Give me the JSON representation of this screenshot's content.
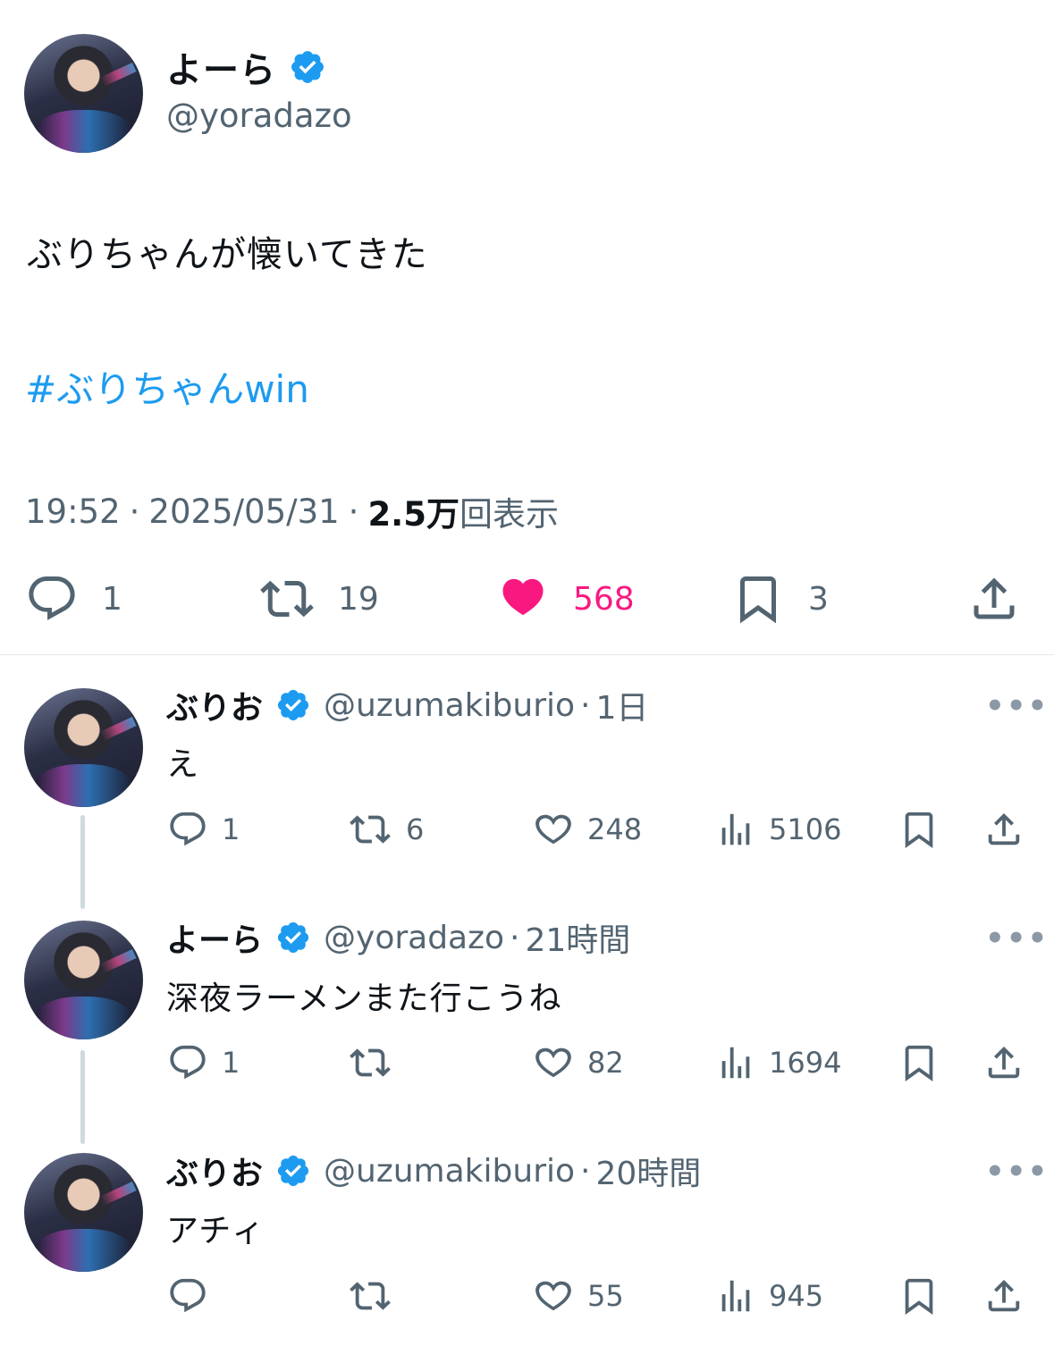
{
  "main": {
    "name": "よーら",
    "handle": "@yoradazo",
    "text": "ぶりちゃんが懐いてきた",
    "hashtag": "#ぶりちゃんwin",
    "time": "19:52",
    "date": "2025/05/31",
    "sep": "·",
    "views_num": "2.5万",
    "views_label": "回表示",
    "replies": "1",
    "retweets": "19",
    "likes": "568",
    "bookmarks": "3"
  },
  "replies": [
    {
      "name": "ぶりお",
      "handle": "@uzumakiburio",
      "sep": "·",
      "time": "1日",
      "text": "え",
      "replies": "1",
      "retweets": "6",
      "likes": "248",
      "views": "5106"
    },
    {
      "name": "よーら",
      "handle": "@yoradazo",
      "sep": "·",
      "time": "21時間",
      "text": "深夜ラーメンまた行こうね",
      "replies": "1",
      "retweets": "",
      "likes": "82",
      "views": "1694"
    },
    {
      "name": "ぶりお",
      "handle": "@uzumakiburio",
      "sep": "·",
      "time": "20時間",
      "text": "アチィ",
      "replies": "",
      "retweets": "",
      "likes": "55",
      "views": "945"
    }
  ],
  "more_label": "•••",
  "colors": {
    "accent": "#1d9bf0",
    "like": "#f91880",
    "secondary": "#536471"
  },
  "icons": [
    "verified-badge-icon",
    "reply-icon",
    "retweet-icon",
    "heart-icon",
    "bookmark-icon",
    "share-icon",
    "views-icon",
    "more-icon"
  ]
}
